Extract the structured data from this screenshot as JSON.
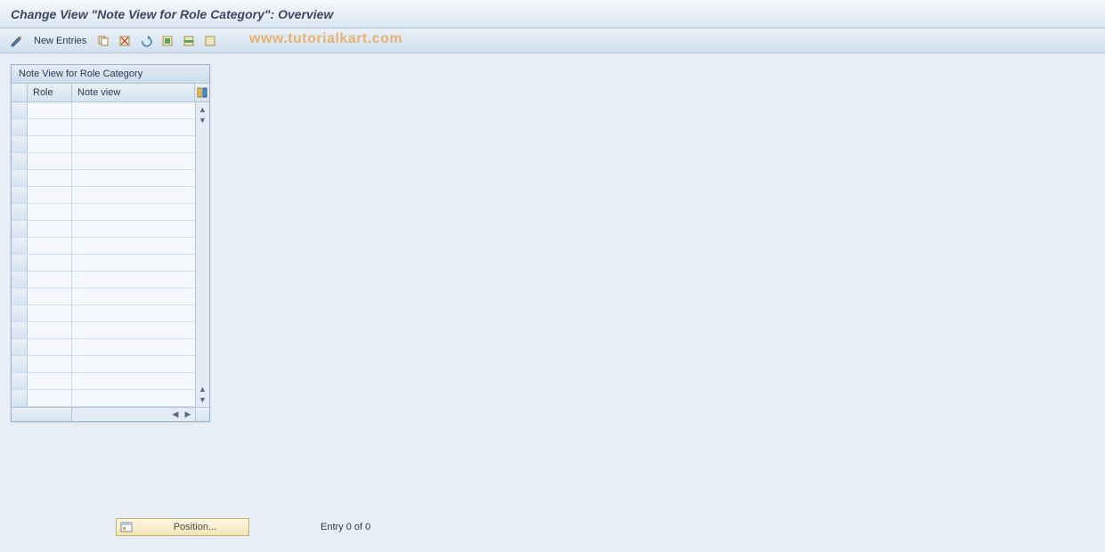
{
  "title": "Change View \"Note View for Role Category\": Overview",
  "watermark": "www.tutorialkart.com",
  "toolbar": {
    "new_entries_label": "New Entries"
  },
  "grid": {
    "title": "Note View for Role Category",
    "columns": {
      "role": "Role",
      "note": "Note view"
    },
    "rows": [
      {
        "role": "",
        "note": ""
      },
      {
        "role": "",
        "note": ""
      },
      {
        "role": "",
        "note": ""
      },
      {
        "role": "",
        "note": ""
      },
      {
        "role": "",
        "note": ""
      },
      {
        "role": "",
        "note": ""
      },
      {
        "role": "",
        "note": ""
      },
      {
        "role": "",
        "note": ""
      },
      {
        "role": "",
        "note": ""
      },
      {
        "role": "",
        "note": ""
      },
      {
        "role": "",
        "note": ""
      },
      {
        "role": "",
        "note": ""
      },
      {
        "role": "",
        "note": ""
      },
      {
        "role": "",
        "note": ""
      },
      {
        "role": "",
        "note": ""
      },
      {
        "role": "",
        "note": ""
      },
      {
        "role": "",
        "note": ""
      },
      {
        "role": "",
        "note": ""
      }
    ]
  },
  "footer": {
    "position_label": "Position...",
    "entry_label": "Entry 0 of 0"
  }
}
